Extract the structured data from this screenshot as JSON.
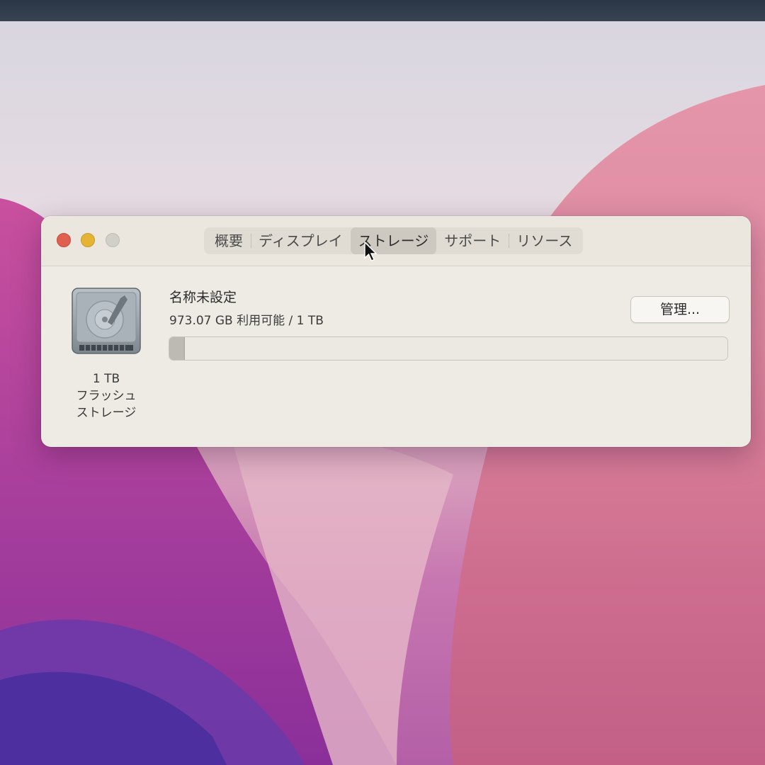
{
  "window": {
    "tabs": [
      {
        "label": "概要",
        "active": false
      },
      {
        "label": "ディスプレイ",
        "active": false
      },
      {
        "label": "ストレージ",
        "active": true
      },
      {
        "label": "サポート",
        "active": false
      },
      {
        "label": "リソース",
        "active": false
      }
    ]
  },
  "storage": {
    "volume_name": "名称未設定",
    "available_text": "973.07 GB 利用可能 / 1 TB",
    "used_fraction": 0.027,
    "manage_button_label": "管理...",
    "disk_caption": [
      "1 TB",
      "フラッシュ",
      "ストレージ"
    ],
    "disk_icon": "hard-drive-icon"
  },
  "colors": {
    "close": "#e0604f",
    "minimize": "#e5b435",
    "zoom_inactive": "#d2cfc9",
    "bar_fill": "#bdbab3"
  }
}
